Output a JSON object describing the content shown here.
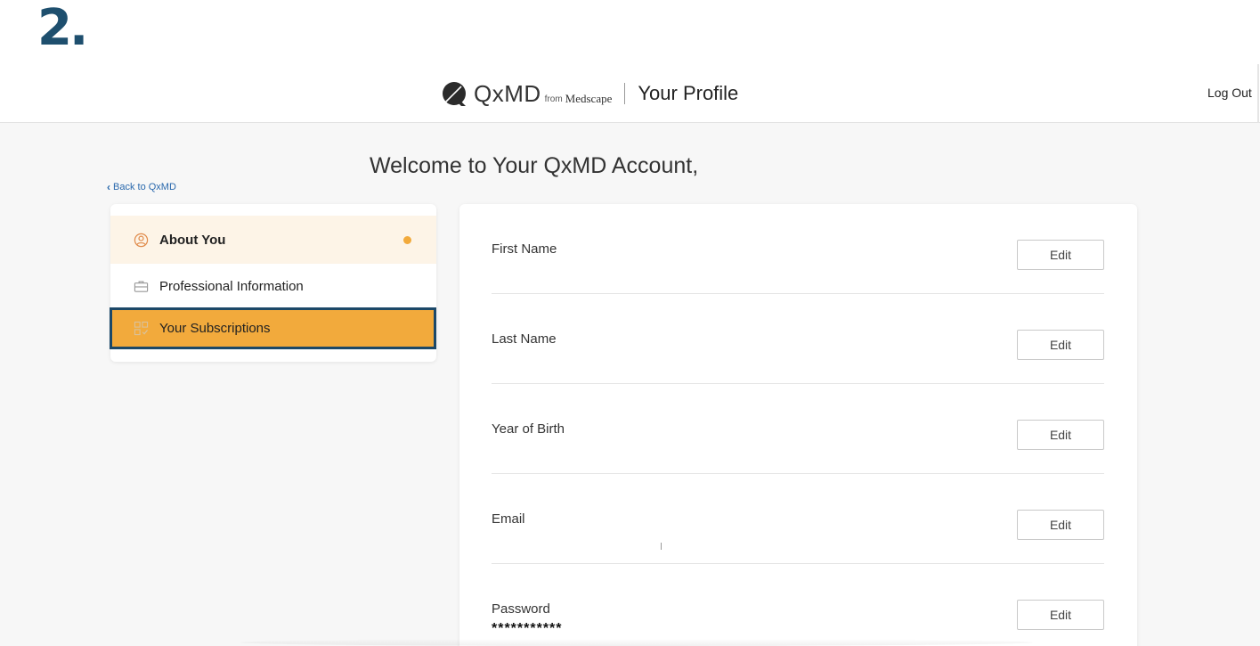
{
  "step": {
    "number": "2."
  },
  "header": {
    "logo_text": "QxMD",
    "logo_from": "from",
    "logo_partner": "Medscape",
    "page_title": "Your Profile",
    "logout_label": "Log Out"
  },
  "main": {
    "welcome": "Welcome to Your QxMD Account,",
    "back_link": "Back to QxMD"
  },
  "sidebar": {
    "items": [
      {
        "label": "About You",
        "icon": "person-circle-icon",
        "state": "active",
        "has_dot": true
      },
      {
        "label": "Professional Information",
        "icon": "briefcase-icon",
        "state": "default"
      },
      {
        "label": "Your Subscriptions",
        "icon": "subscriptions-grid-icon",
        "state": "highlighted"
      }
    ]
  },
  "form": {
    "edit_label": "Edit",
    "fields": [
      {
        "label": "First Name",
        "value": ""
      },
      {
        "label": "Last Name",
        "value": ""
      },
      {
        "label": "Year of Birth",
        "value": ""
      },
      {
        "label": "Email",
        "value": ""
      },
      {
        "label": "Password",
        "value": "***********"
      }
    ]
  },
  "colors": {
    "accent_orange": "#f2aa3c",
    "active_bg": "#fdf4e7",
    "highlight_border": "#1c4868",
    "step_blue": "#1e4f6e",
    "link_blue": "#2a69ad"
  }
}
